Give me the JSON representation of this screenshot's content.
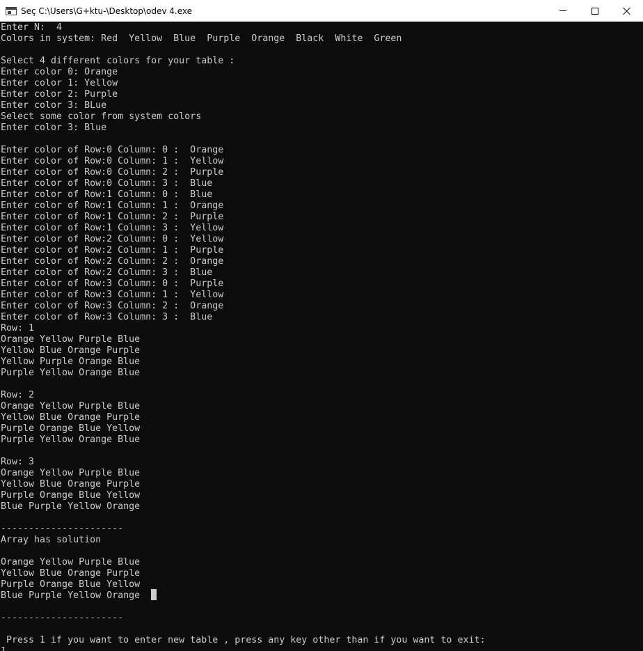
{
  "window": {
    "title": "Seç C:\\Users\\G+ktu-\\Desktop\\odev 4.exe",
    "icon": "console-app-icon",
    "controls": {
      "minimize_icon": "minimize-icon",
      "maximize_icon": "maximize-icon",
      "close_icon": "close-icon"
    }
  },
  "colors": {
    "console_background": "#0c0c0c",
    "console_text": "#cccccc",
    "titlebar_background": "#ffffff"
  },
  "console": {
    "lines": [
      "Enter N:  4",
      "Colors in system: Red  Yellow  Blue  Purple  Orange  Black  White  Green",
      "",
      "Select 4 different colors for your table :",
      "Enter color 0: Orange",
      "Enter color 1: Yellow",
      "Enter color 2: Purple",
      "Enter color 3: BLue",
      "Select some color from system colors",
      "Enter color 3: Blue",
      "",
      "Enter color of Row:0 Column: 0 :  Orange",
      "Enter color of Row:0 Column: 1 :  Yellow",
      "Enter color of Row:0 Column: 2 :  Purple",
      "Enter color of Row:0 Column: 3 :  Blue",
      "Enter color of Row:1 Column: 0 :  Blue",
      "Enter color of Row:1 Column: 1 :  Orange",
      "Enter color of Row:1 Column: 2 :  Purple",
      "Enter color of Row:1 Column: 3 :  Yellow",
      "Enter color of Row:2 Column: 0 :  Yellow",
      "Enter color of Row:2 Column: 1 :  Purple",
      "Enter color of Row:2 Column: 2 :  Orange",
      "Enter color of Row:2 Column: 3 :  Blue",
      "Enter color of Row:3 Column: 0 :  Purple",
      "Enter color of Row:3 Column: 1 :  Yellow",
      "Enter color of Row:3 Column: 2 :  Orange",
      "Enter color of Row:3 Column: 3 :  Blue",
      "Row: 1",
      "Orange Yellow Purple Blue",
      "Yellow Blue Orange Purple",
      "Yellow Purple Orange Blue",
      "Purple Yellow Orange Blue",
      "",
      "Row: 2",
      "Orange Yellow Purple Blue",
      "Yellow Blue Orange Purple",
      "Purple Orange Blue Yellow",
      "Purple Yellow Orange Blue",
      "",
      "Row: 3",
      "Orange Yellow Purple Blue",
      "Yellow Blue Orange Purple",
      "Purple Orange Blue Yellow",
      "Blue Purple Yellow Orange",
      "",
      "----------------------",
      "Array has solution",
      "",
      "Orange Yellow Purple Blue",
      "Yellow Blue Orange Purple",
      "Purple Orange Blue Yellow",
      "Blue Purple Yellow Orange",
      "",
      "----------------------",
      "",
      " Press 1 if you want to enter new table , press any key other than if you want to exit:",
      "1"
    ]
  }
}
